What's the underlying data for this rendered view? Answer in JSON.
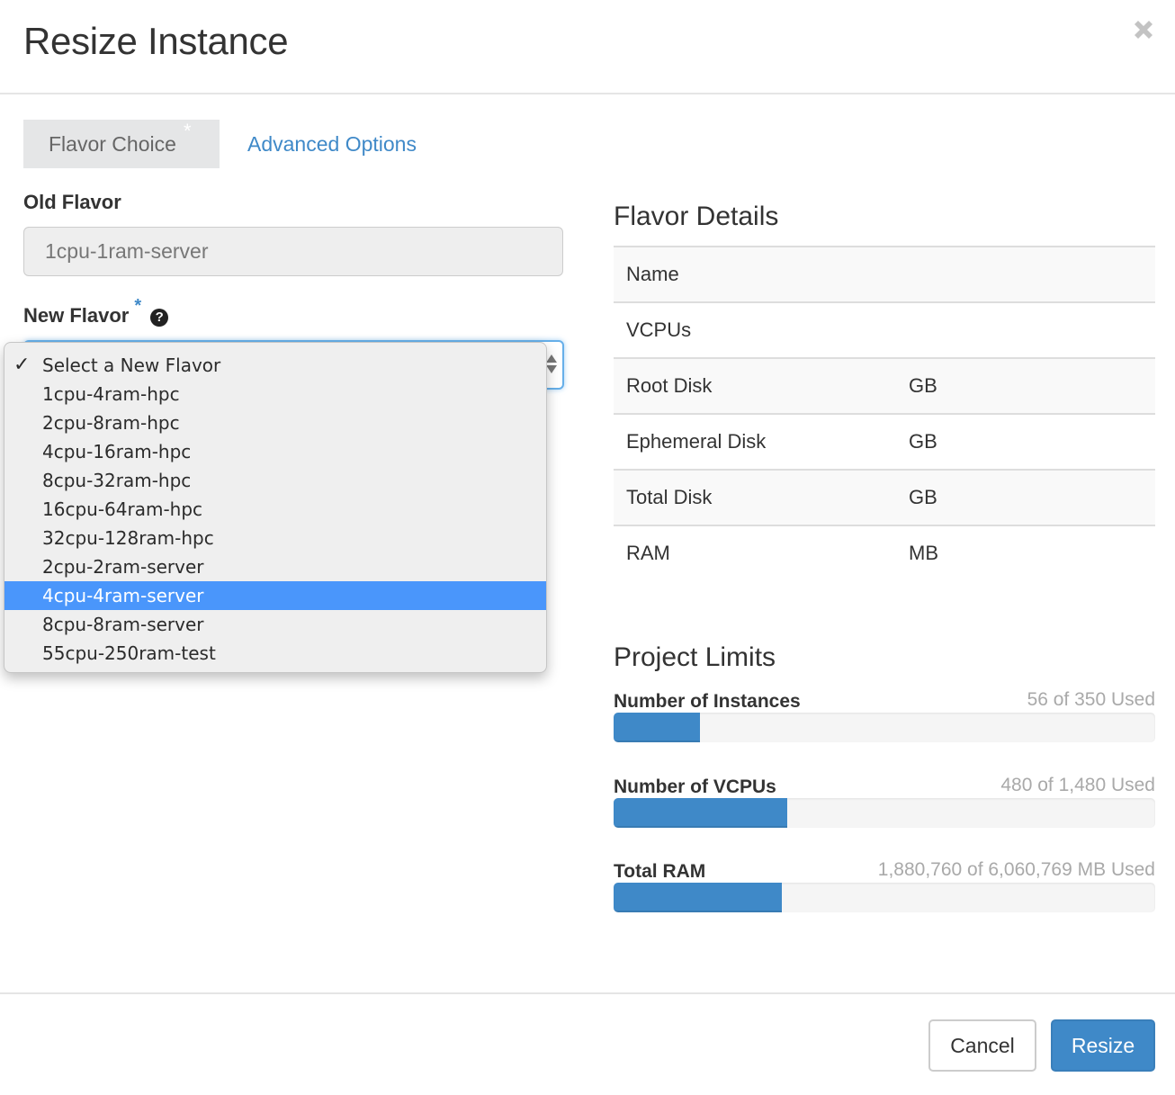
{
  "dialog": {
    "title": "Resize Instance",
    "close_icon": "close-x-icon"
  },
  "tabs": [
    {
      "label": "Flavor Choice",
      "required_marker": "*",
      "active": true
    },
    {
      "label": "Advanced Options",
      "active": false
    }
  ],
  "form": {
    "old_flavor": {
      "label": "Old Flavor",
      "value": "1cpu-1ram-server"
    },
    "new_flavor": {
      "label": "New Flavor",
      "required_marker": "*",
      "help_icon": "question-circle-icon",
      "help_glyph": "?",
      "selected_value": "Select a New Flavor",
      "check_glyph": "✓",
      "highlighted_option": "4cpu-4ram-server",
      "options": [
        "Select a New Flavor",
        "1cpu-4ram-hpc",
        "2cpu-8ram-hpc",
        "4cpu-16ram-hpc",
        "8cpu-32ram-hpc",
        "16cpu-64ram-hpc",
        "32cpu-128ram-hpc",
        "2cpu-2ram-server",
        "4cpu-4ram-server",
        "8cpu-8ram-server",
        "55cpu-250ram-test"
      ]
    }
  },
  "flavor_details": {
    "title": "Flavor Details",
    "rows": [
      {
        "label": "Name",
        "value": ""
      },
      {
        "label": "VCPUs",
        "value": ""
      },
      {
        "label": "Root Disk",
        "value": "GB"
      },
      {
        "label": "Ephemeral Disk",
        "value": "GB"
      },
      {
        "label": "Total Disk",
        "value": "GB"
      },
      {
        "label": "RAM",
        "value": "MB"
      }
    ]
  },
  "project_limits": {
    "title": "Project Limits",
    "items": [
      {
        "label": "Number of Instances",
        "used_text": "56 of 350 Used",
        "used": 56,
        "total": 350,
        "fill_percent": 16
      },
      {
        "label": "Number of VCPUs",
        "used_text": "480 of 1,480 Used",
        "used": 480,
        "total": 1480,
        "fill_percent": 32
      },
      {
        "label": "Total RAM",
        "used_text": "1,880,760 of 6,060,769 MB Used",
        "used": 1880760,
        "total": 6060769,
        "fill_percent": 31
      }
    ]
  },
  "footer": {
    "cancel_label": "Cancel",
    "submit_label": "Resize"
  },
  "colors": {
    "accent": "#3f89c8",
    "highlight": "#4a96fb",
    "muted_text": "#a9a9a9"
  }
}
